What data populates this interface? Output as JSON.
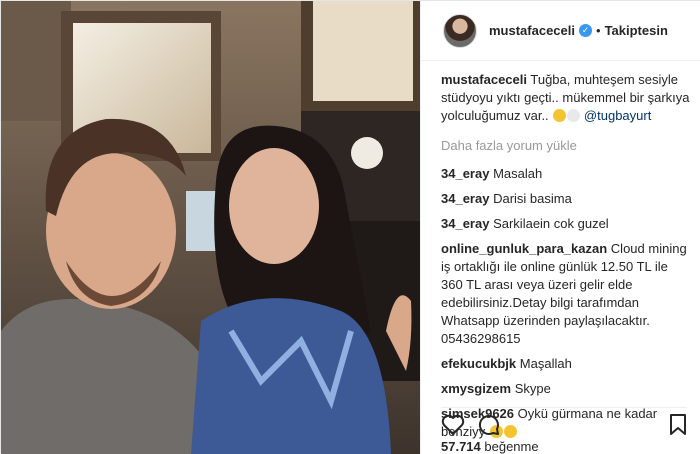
{
  "post": {
    "username": "mustafaceceli",
    "follow_label": "Takiptesin",
    "separator": "•"
  },
  "caption": {
    "user": "mustafaceceli",
    "text": "Tuğba, muhteşem sesiyle stüdyoyu yıktı geçti.. mükemmel bir şarkıya yolculuğumuz var..",
    "mention": "@tugbayurt"
  },
  "load_more_label": "Daha fazla yorum yükle",
  "comments": [
    {
      "user": "34_eray",
      "text": "Masalah"
    },
    {
      "user": "34_eray",
      "text": "Darisi basima"
    },
    {
      "user": "34_eray",
      "text": "Sarkilaein cok guzel"
    },
    {
      "user": "online_gunluk_para_kazan",
      "text": "Cloud mining iş ortaklığı ile online günlük 12.50 TL ile 360 TL arası veya üzeri gelir elde edebilirsiniz.Detay bilgi tarafımdan Whatsapp üzerinden paylaşılacaktır. 05436298615"
    },
    {
      "user": "efekucukbjk",
      "text": "Maşallah"
    },
    {
      "user": "xmysgizem",
      "text": "Skype"
    },
    {
      "user": "simsek9626",
      "text": "Öykü gürmana ne kadar benziyy"
    }
  ],
  "icons": {
    "verified": "verified-badge-icon",
    "like": "heart-icon",
    "comment": "comment-icon",
    "save": "bookmark-icon"
  },
  "likes": {
    "count": "57.714",
    "label": "beğenme"
  },
  "colors": {
    "verified": "#3897f0",
    "mention": "#003569",
    "muted": "#999999"
  }
}
